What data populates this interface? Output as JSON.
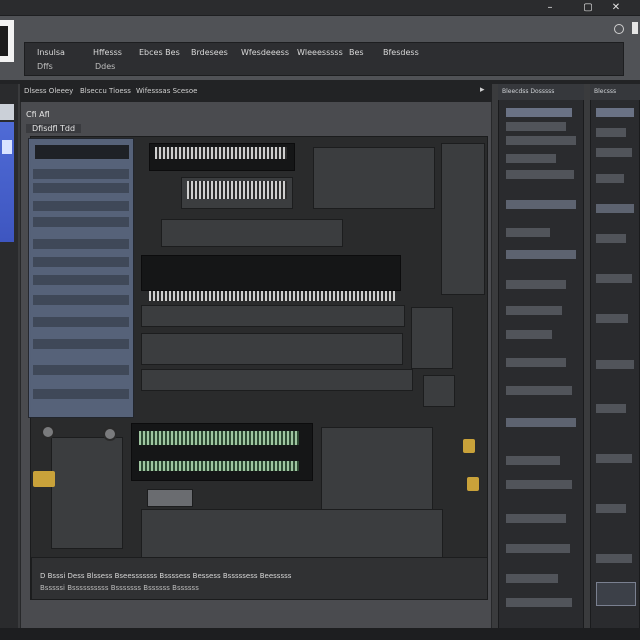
{
  "window": {
    "minimize": "–",
    "restore": "▢",
    "close": "✕"
  },
  "header": {
    "logo": "logo-icon",
    "menu": [
      {
        "label": "Insulsa",
        "sub": "Dffs"
      },
      {
        "label": "Hffesss",
        "sub": "Ddes"
      },
      {
        "label": "Ebces Bes",
        "sub": ""
      },
      {
        "label": "Brdesees",
        "sub": ""
      },
      {
        "label": "Wfesdeeess",
        "sub": ""
      },
      {
        "label": "Wleeesssss",
        "sub": ""
      },
      {
        "label": "Bes",
        "sub": ""
      },
      {
        "label": "Bfesdess",
        "sub": ""
      }
    ]
  },
  "main": {
    "tabs": [
      "Dlsess Oleeey",
      "Blseccu Tioess",
      "Wifesssas Scesoe"
    ],
    "crumb": "Cfi Afl",
    "subtitle": "Dfisdfl Tdd",
    "footer_line1": "D   Bsssi Dess   Blssess   Bseesssssss Bssssess Bessess   Bsssssess Beesssss",
    "footer_line2": "Bsssssi   Bssssssssss  Bsssssss  Bssssss  Bssssss"
  },
  "right_panel": {
    "title": "Bleecdss Dosssss"
  },
  "far_right_panel": {
    "title": "Blecsss"
  },
  "colors": {
    "accent": "#4f6bd6",
    "panel": "#2a2b2e",
    "board": "#2a2b2c"
  }
}
